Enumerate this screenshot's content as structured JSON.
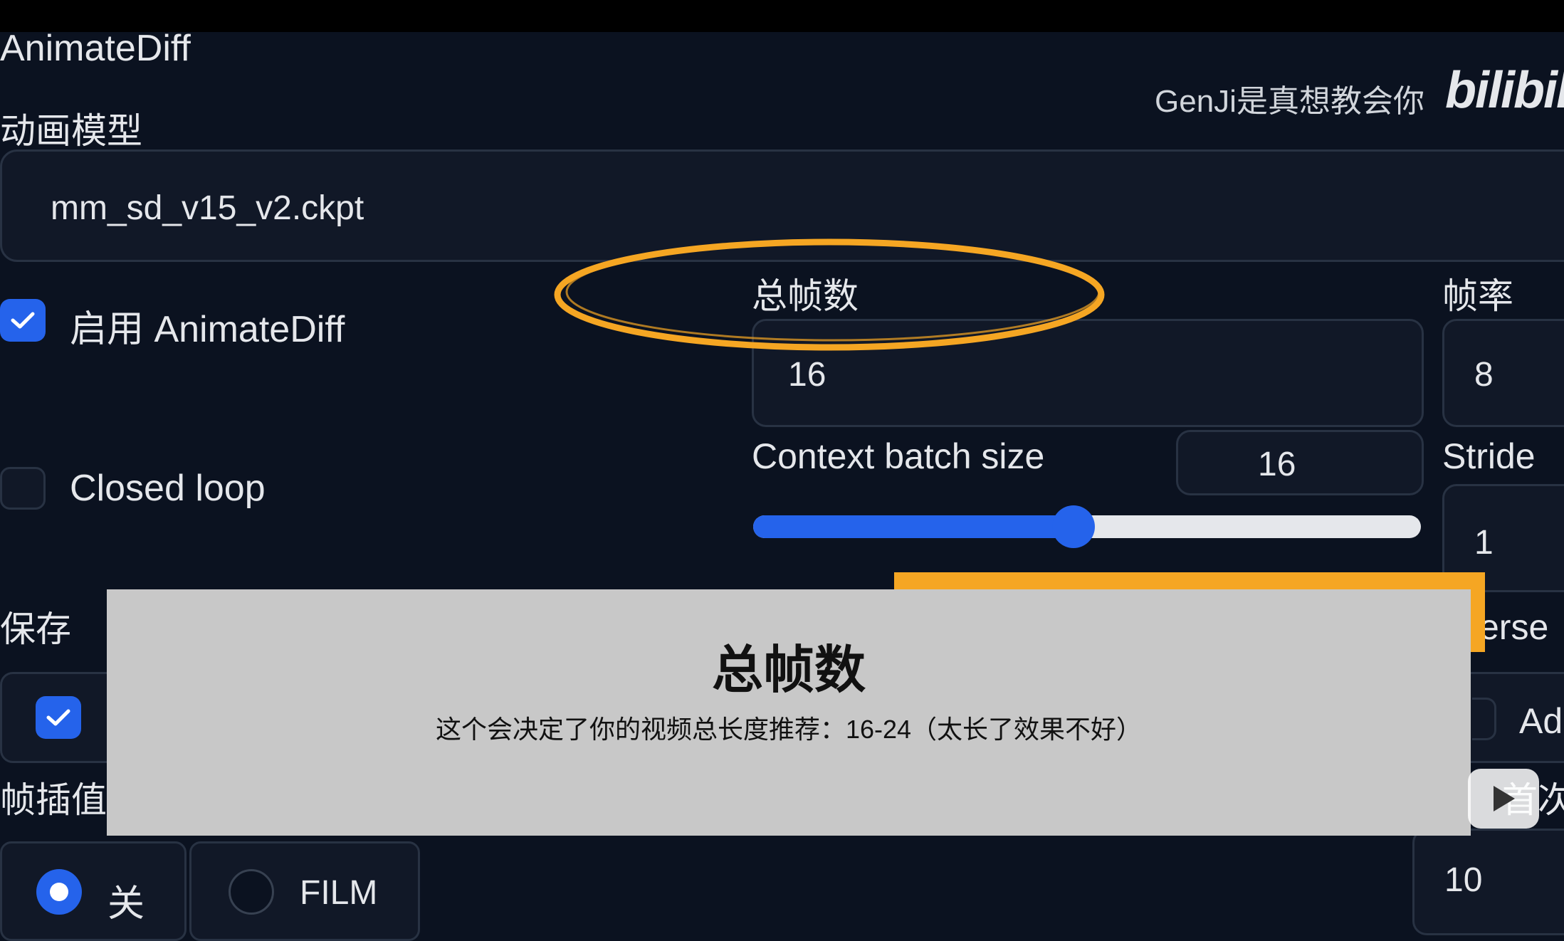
{
  "watermark": {
    "text": "GenJi是真想教会你",
    "brand": "bilibili"
  },
  "section": {
    "title": "AnimateDiff"
  },
  "motion_model": {
    "label": "动画模型",
    "value": "mm_sd_v15_v2.ckpt"
  },
  "enable": {
    "label": "启用 AnimateDiff",
    "checked": true
  },
  "closed_loop": {
    "label": "Closed loop",
    "checked": false
  },
  "total_frames": {
    "label": "总帧数",
    "value": "16"
  },
  "fps": {
    "label": "帧率",
    "value": "8"
  },
  "context_batch": {
    "label": "Context batch size",
    "value": "16",
    "slider_fraction": 0.48
  },
  "stride": {
    "label": "Stride",
    "value": "1"
  },
  "save": {
    "label": "保存"
  },
  "interp": {
    "label": "帧插值",
    "opt_off": "关",
    "opt_film": "FILM",
    "value": "10"
  },
  "reverse_partial": "erse",
  "add_partial": "Ad",
  "right_partial": "首次数",
  "overlay": {
    "title": "总帧数",
    "body": "这个会决定了你的视频总长度推荐：16-24（太长了效果不好）"
  },
  "colors": {
    "accent": "#2563eb",
    "annotation": "#f5a623",
    "background": "#0b1220"
  }
}
